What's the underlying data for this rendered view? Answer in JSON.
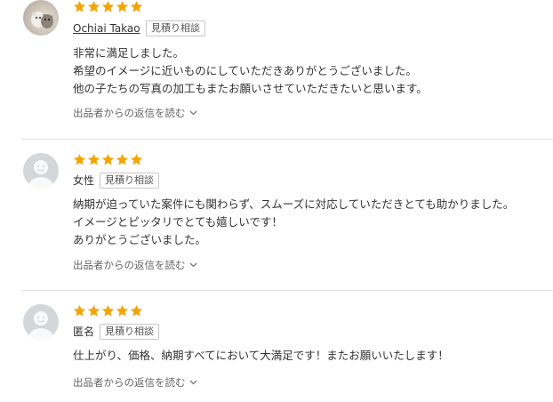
{
  "colors": {
    "star": "#f5a300",
    "text": "#333333",
    "muted": "#666666",
    "divider": "#e2e2e2"
  },
  "reviews": [
    {
      "rating": 5,
      "avatar": "reviewer-photo",
      "reviewer_name": "Ochiai Takao",
      "tag": "見積り相談",
      "body": "非常に満足しました。\n希望のイメージに近いものにしていただきありがとうございました。\n他の子たちの写真の加工もまたお願いさせていただきたいと思います。",
      "reply_link": "出品者からの返信を読む"
    },
    {
      "rating": 5,
      "avatar": "default-user-avatar",
      "reviewer_name": "女性",
      "tag": "見積り相談",
      "body": "納期が迫っていた案件にも関わらず、スムーズに対応していただきとても助かりました。\nイメージとピッタリでとても嬉しいです！\nありがとうございました。",
      "reply_link": "出品者からの返信を読む"
    },
    {
      "rating": 5,
      "avatar": "default-user-avatar",
      "reviewer_name": "匿名",
      "tag": "見積り相談",
      "body": "仕上がり、価格、納期すべてにおいて大満足です！またお願いいたします！",
      "reply_link": "出品者からの返信を読む"
    }
  ]
}
